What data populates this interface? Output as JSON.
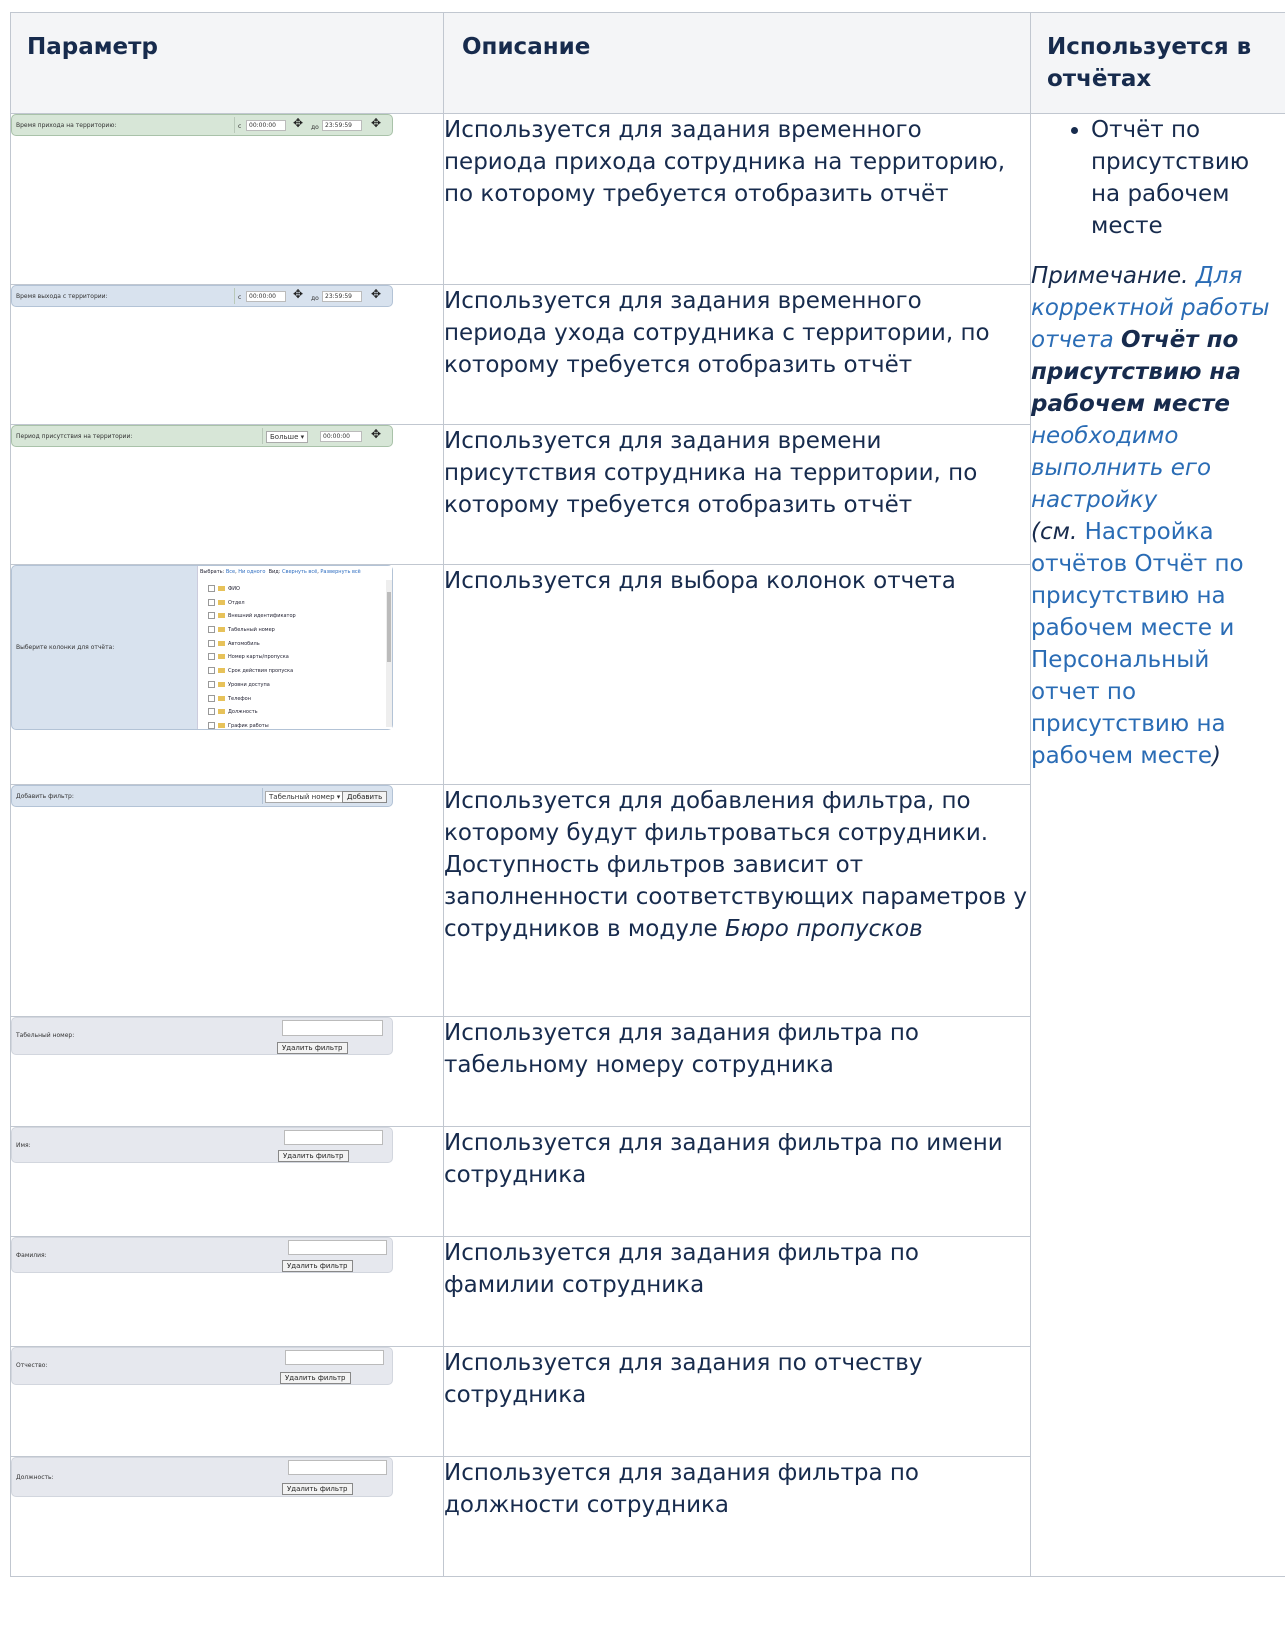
{
  "headers": {
    "param": "Параметр",
    "desc": "Описание",
    "used": "Используется в отчётах"
  },
  "rows": [
    {
      "desc": "Используется для задания временного периода прихода сотрудника на территорию, по которому требуется отобразить отчёт",
      "widget": {
        "label": "Время прихода на территорию:",
        "from_label": "с",
        "from_value": "00:00:00",
        "to_label": "до",
        "to_value": "23:59:59",
        "icon": "move-icon"
      }
    },
    {
      "desc": "Используется для задания временного периода ухода сотрудника с территории, по которому требуется отобразить отчёт",
      "widget": {
        "label": "Время выхода с территории:",
        "from_label": "с",
        "from_value": "00:00:00",
        "to_label": "до",
        "to_value": "23:59:59",
        "icon": "move-icon"
      }
    },
    {
      "desc": "Используется для задания времени присутствия сотрудника на территории, по которому требуется отобразить отчёт",
      "widget": {
        "label": "Период присутствия на территории:",
        "select": "Больше",
        "value": "00:00:00",
        "icon": "move-icon"
      }
    },
    {
      "desc": "Используется для выбора колонок отчета",
      "widget": {
        "label": "Выберите колонки для отчёта:",
        "select_label": "Выбрать:",
        "all": "Все",
        "none": "Ни одного",
        "view_label": "Вид:",
        "collapse": "Свернуть всё",
        "expand": "Развернуть всё",
        "items": [
          "ФИО",
          "Отдел",
          "Внешний идентификатор",
          "Табельный номер",
          "Автомобиль",
          "Номер карты/пропуска",
          "Срок действия пропуска",
          "Уровни доступа",
          "Телефон",
          "Должность",
          "График работы"
        ]
      }
    },
    {
      "desc_prefix": "Используется для добавления фильтра, по которому будут фильтроваться сотрудники. Доступность фильтров зависит от заполненности соответствующих параметров у сотрудников в модуле ",
      "desc_em": "Бюро пропусков",
      "widget": {
        "label": "Добавить фильтр:",
        "select": "Табельный номер",
        "button": "Добавить"
      }
    },
    {
      "desc": "Используется для задания фильтра по табельному номеру сотрудника",
      "widget": {
        "label": "Табельный номер:",
        "button": "Удалить фильтр"
      }
    },
    {
      "desc": "Используется для задания фильтра по имени сотрудника",
      "widget": {
        "label": "Имя:",
        "button": "Удалить фильтр"
      }
    },
    {
      "desc": "Используется для задания фильтра по фамилии сотрудника",
      "widget": {
        "label": "Фамилия:",
        "button": "Удалить фильтр"
      }
    },
    {
      "desc": "Используется для задания по отчеству сотрудника",
      "widget": {
        "label": "Отчество:",
        "button": "Удалить фильтр"
      }
    },
    {
      "desc": "Используется для задания фильтра по должности сотрудника",
      "widget": {
        "label": "Должность:",
        "button": "Удалить фильтр"
      }
    }
  ],
  "used": {
    "report": "Отчёт по присутствию на рабочем месте",
    "note_prefix": "Примечание.",
    "note_link1": "Для корректной работы отчета",
    "note_bold": "Отчёт по присутствию на рабочем месте",
    "note_link2": "необходимо выполнить его настройку",
    "see_prefix": "(см.",
    "see_link": "Настройка отчётов Отчёт по присутствию на рабочем месте и Персональный отчет по присутствию на рабочем месте",
    "see_suffix": ")"
  }
}
